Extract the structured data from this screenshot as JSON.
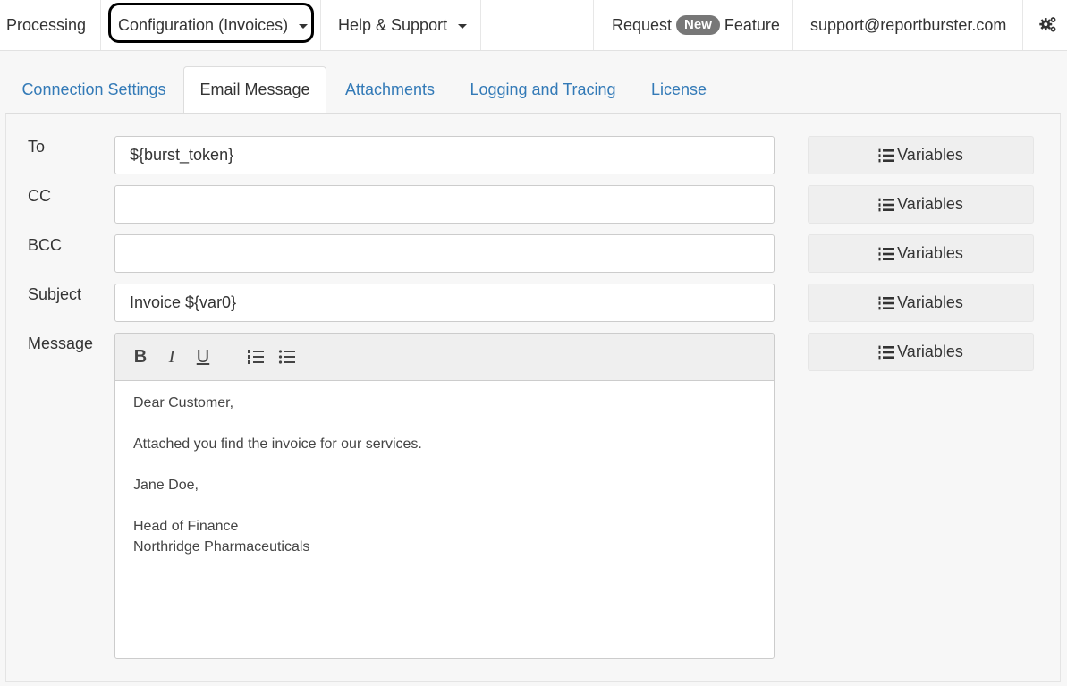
{
  "navbar": {
    "processing": "Processing",
    "configuration": "Configuration (Invoices)",
    "help": "Help & Support",
    "request_prefix": "Request",
    "request_badge": "New",
    "request_suffix": "Feature",
    "support_email": "support@reportburster.com",
    "settings_icon": "gears-icon"
  },
  "tabs": [
    {
      "label": "Connection Settings"
    },
    {
      "label": "Email Message",
      "active": true
    },
    {
      "label": "Attachments"
    },
    {
      "label": "Logging and Tracing"
    },
    {
      "label": "License"
    }
  ],
  "form": {
    "to": {
      "label": "To",
      "value": "${burst_token}"
    },
    "cc": {
      "label": "CC",
      "value": ""
    },
    "bcc": {
      "label": "BCC",
      "value": ""
    },
    "subject": {
      "label": "Subject",
      "value": "Invoice ${var0}"
    },
    "message": {
      "label": "Message"
    },
    "variables_label": "Variables"
  },
  "editor": {
    "toolbar": {
      "bold": "B",
      "italic": "I",
      "underline": "U"
    },
    "lines": [
      "Dear Customer,",
      "",
      "Attached you find the invoice for our services.",
      "",
      "Jane Doe,",
      "",
      "Head of Finance",
      "Northridge Pharmaceuticals"
    ]
  },
  "colors": {
    "link": "#337ab7",
    "badge": "#777777",
    "panel": "#f7f7f7"
  }
}
